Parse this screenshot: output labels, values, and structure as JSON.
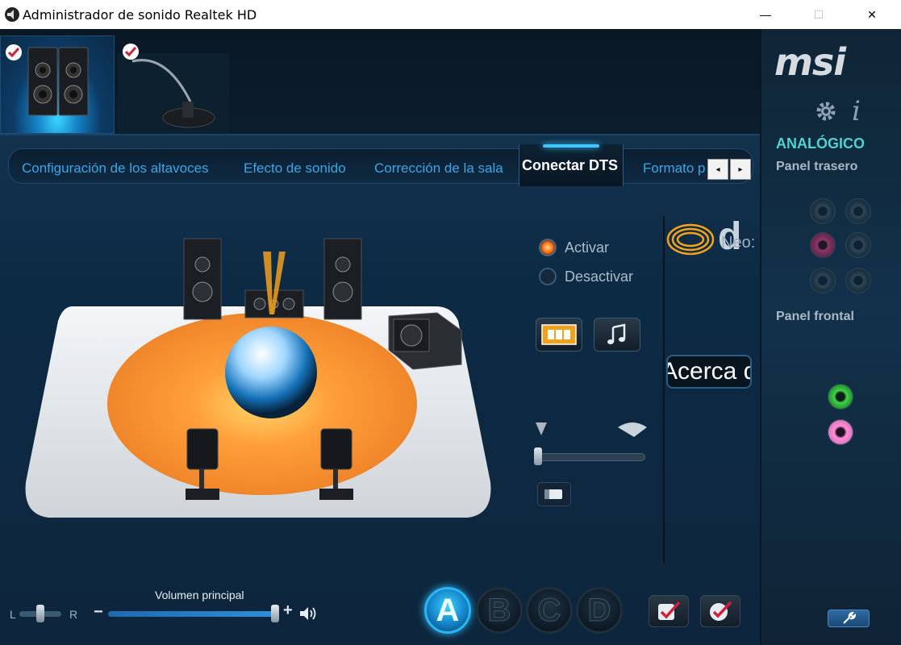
{
  "window": {
    "title": "Administrador de sonido Realtek HD",
    "minimize_label": "—",
    "maximize_label": "☐",
    "close_label": "✕"
  },
  "devices": {
    "speaker_selected": true,
    "microphone_selected": false
  },
  "tabs": [
    {
      "label": "Configuración de los altavoces"
    },
    {
      "label": "Efecto de sonido"
    },
    {
      "label": "Corrección de la sala"
    },
    {
      "label": "Conectar DTS"
    },
    {
      "label": "Formato p"
    }
  ],
  "active_tab": "Conectar DTS",
  "tab_nav": {
    "left": "◂",
    "right": "▸"
  },
  "dts": {
    "activate_label": "Activar",
    "deactivate_label": "Desactivar",
    "activated": true,
    "neo_label": "Neo:",
    "logo_text": "d",
    "about_label": "Acerca de",
    "level": 0
  },
  "right_panel": {
    "brand": "msi",
    "info_label": "i",
    "mode_label": "ANALÓGICO",
    "rear_panel_label": "Panel trasero",
    "front_panel_label": "Panel frontal",
    "accent_color": "#4fd2d2"
  },
  "volume": {
    "label": "Volumen principal",
    "balance_left": "L",
    "balance_right": "R",
    "minus": "−",
    "plus": "+",
    "level": 1.0
  },
  "profiles": [
    {
      "label": "A",
      "selected": true
    },
    {
      "label": "B",
      "selected": false
    },
    {
      "label": "C",
      "selected": false
    },
    {
      "label": "D",
      "selected": false
    }
  ],
  "icons": {
    "app": "speaker-icon",
    "gear": "gear-icon",
    "info": "info-icon",
    "wrench": "wrench-icon",
    "movie": "film-icon",
    "music": "music-note-icon"
  }
}
